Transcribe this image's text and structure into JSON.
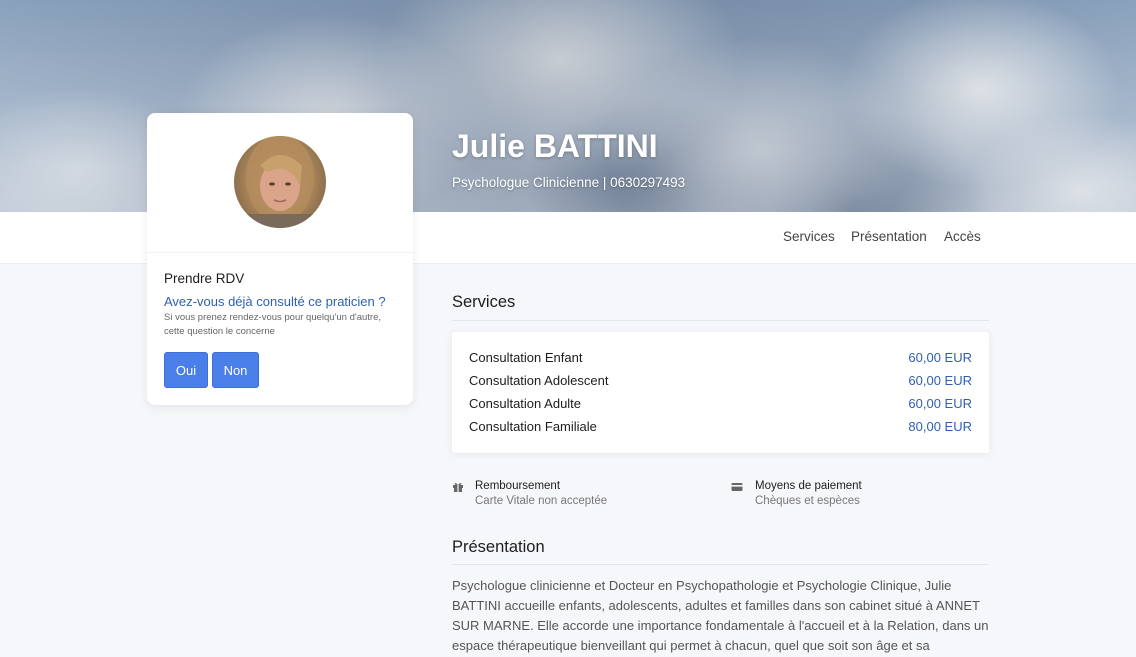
{
  "profile": {
    "name": "Julie BATTINI",
    "subtitle": "Psychologue Clinicienne | 0630297493"
  },
  "nav": {
    "items": [
      "Services",
      "Présentation",
      "Accès"
    ]
  },
  "booking": {
    "title": "Prendre RDV",
    "question": "Avez-vous déjà consulté ce praticien ?",
    "hint": "Si vous prenez rendez-vous pour quelqu'un d'autre, cette question le concerne",
    "yes_label": "Oui",
    "no_label": "Non"
  },
  "services": {
    "title": "Services",
    "items": [
      {
        "name": "Consultation Enfant",
        "price": "60,00 EUR"
      },
      {
        "name": "Consultation Adolescent",
        "price": "60,00 EUR"
      },
      {
        "name": "Consultation Adulte",
        "price": "60,00 EUR"
      },
      {
        "name": "Consultation Familiale",
        "price": "80,00 EUR"
      }
    ]
  },
  "info": {
    "reimbursement_label": "Remboursement",
    "reimbursement_value": "Carte Vitale non acceptée",
    "payment_label": "Moyens de paiement",
    "payment_value": "Chèques et espèces"
  },
  "presentation": {
    "title": "Présentation",
    "text": "Psychologue clinicienne et Docteur en Psychopathologie et Psychologie Clinique, Julie BATTINI accueille enfants, adolescents, adultes et familles dans son cabinet situé à ANNET SUR MARNE. Elle accorde une importance fondamentale à l'accueil et à la Relation, dans un espace thérapeutique bienveillant qui permet à chacun, quel que soit son âge et sa"
  },
  "colors": {
    "accent": "#4a7ee8",
    "link": "#2f5fb3",
    "background": "#f6f7fa"
  },
  "icons": {
    "reimbursement": "gift-icon",
    "payment": "credit-card-icon"
  }
}
